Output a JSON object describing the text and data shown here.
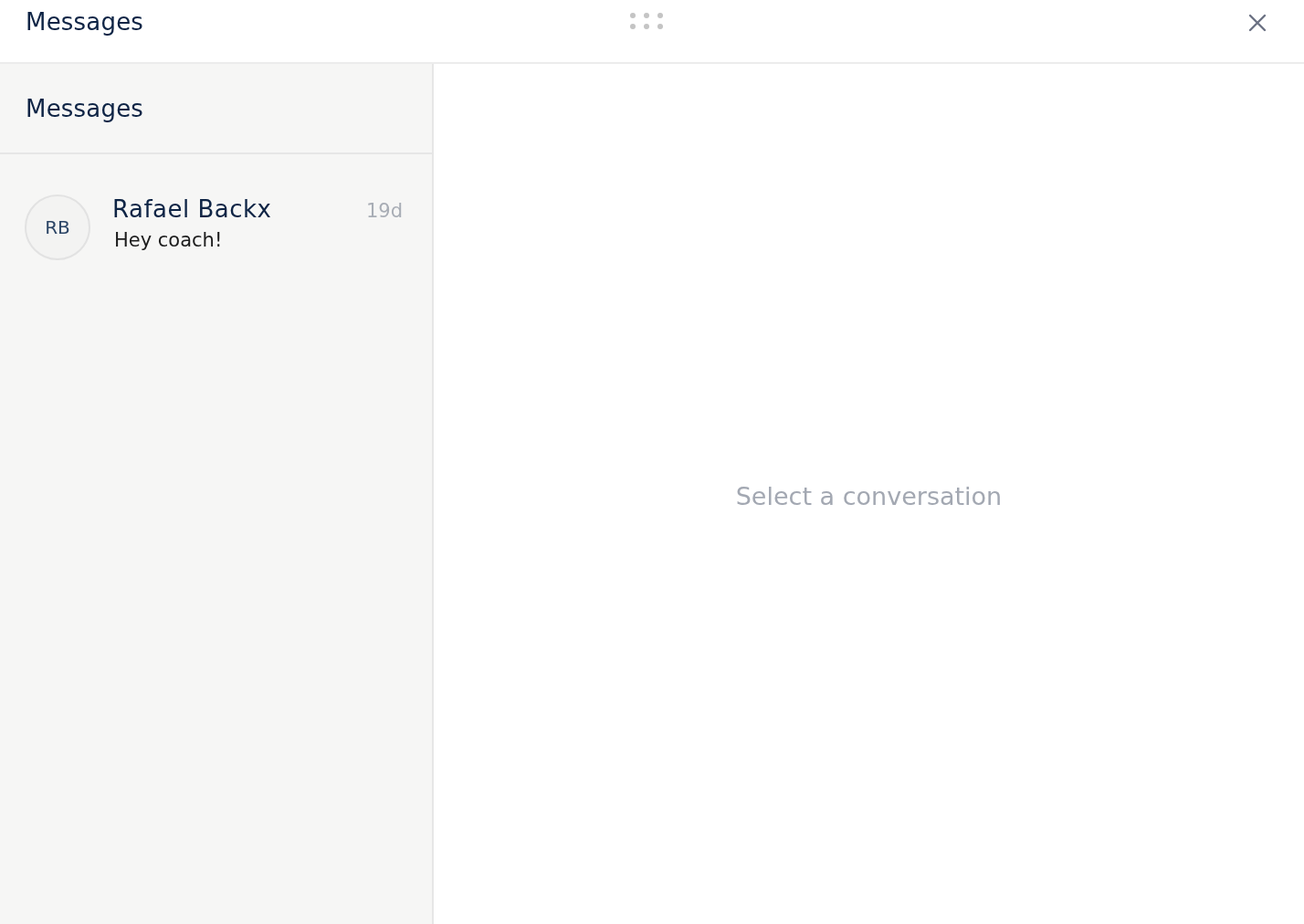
{
  "window": {
    "title": "Messages"
  },
  "sidebar": {
    "title": "Messages",
    "conversations": [
      {
        "initials": "RB",
        "name": "Rafael Backx",
        "preview": "Hey coach!",
        "time": "19d",
        "selected": false
      }
    ]
  },
  "main": {
    "empty_text": "Select a conversation"
  }
}
